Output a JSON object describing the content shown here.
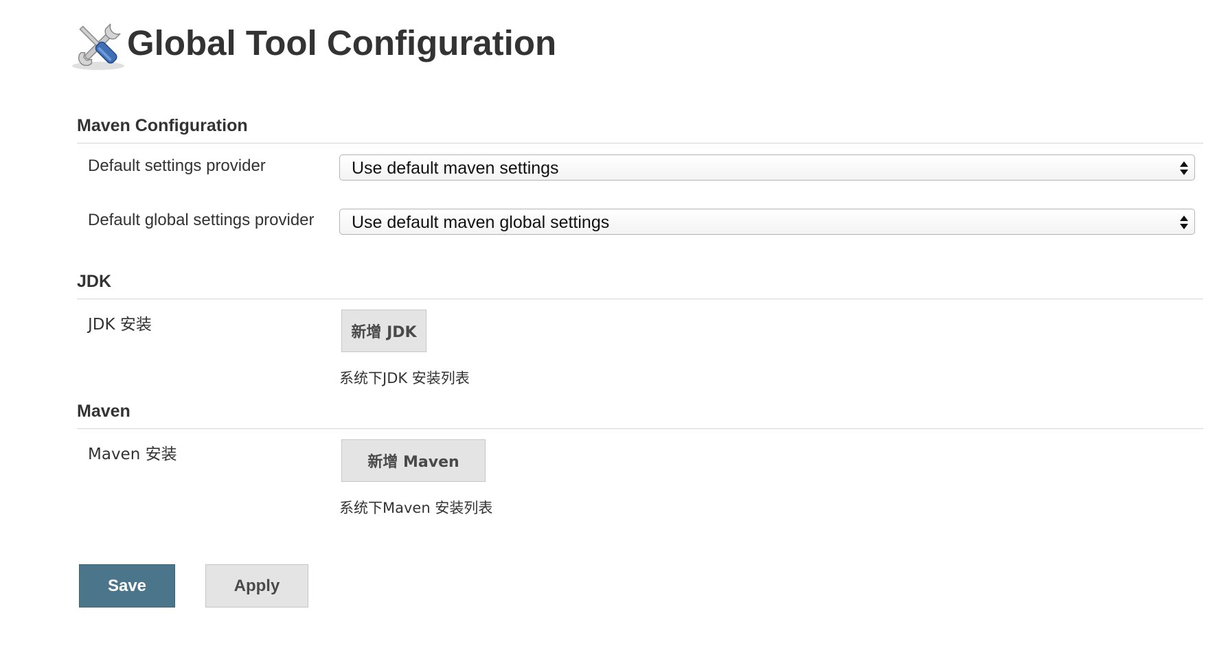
{
  "header": {
    "title": "Global Tool Configuration",
    "icon": "tools-icon"
  },
  "maven_config": {
    "title": "Maven Configuration",
    "default_settings_label": "Default settings provider",
    "default_settings_value": "Use default maven settings",
    "global_settings_label": "Default global settings provider",
    "global_settings_value": "Use default maven global settings"
  },
  "jdk": {
    "title": "JDK",
    "install_label": "JDK 安装",
    "add_button": "新增 JDK",
    "hint": "系统下JDK 安装列表"
  },
  "maven": {
    "title": "Maven",
    "install_label": "Maven 安装",
    "add_button": "新增 Maven",
    "hint": "系统下Maven 安装列表"
  },
  "actions": {
    "save_label": "Save",
    "apply_label": "Apply"
  },
  "colors": {
    "save_button_bg": "#4b758b",
    "secondary_button_bg": "#e4e4e4",
    "text": "#333333"
  }
}
